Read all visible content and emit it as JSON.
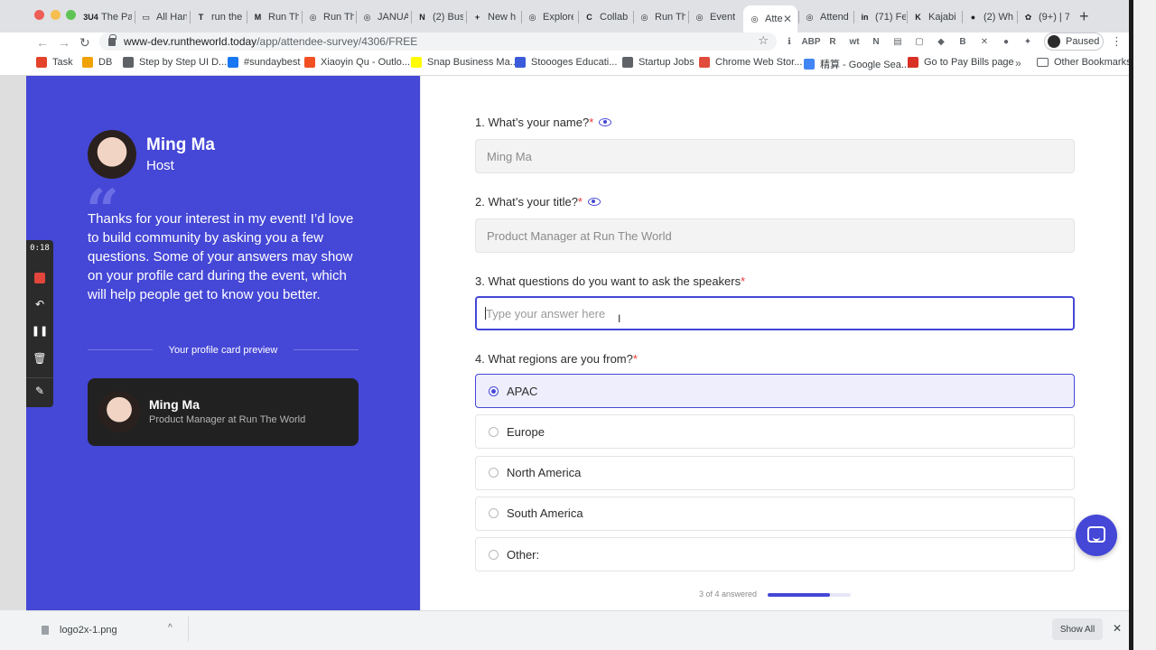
{
  "browser": {
    "tabs": [
      {
        "favicon": "3U4",
        "label": "The Pa",
        "active": false
      },
      {
        "favicon": "▭",
        "label": "All Han",
        "active": false
      },
      {
        "favicon": "T",
        "label": "run the",
        "active": false
      },
      {
        "favicon": "M",
        "label": "Run Th",
        "active": false
      },
      {
        "favicon": "◎",
        "label": "Run Th",
        "active": false
      },
      {
        "favicon": "◎",
        "label": "JANUA",
        "active": false
      },
      {
        "favicon": "N",
        "label": "(2) Bus",
        "active": false
      },
      {
        "favicon": "+",
        "label": "New h",
        "active": false
      },
      {
        "favicon": "◎",
        "label": "Explore",
        "active": false
      },
      {
        "favicon": "C",
        "label": "Collab",
        "active": false
      },
      {
        "favicon": "◎",
        "label": "Run Th",
        "active": false
      },
      {
        "favicon": "◎",
        "label": "Event",
        "active": false
      },
      {
        "favicon": "◎",
        "label": "Atte",
        "active": true
      },
      {
        "favicon": "◎",
        "label": "Attend",
        "active": false
      },
      {
        "favicon": "in",
        "label": "(71) Fe",
        "active": false
      },
      {
        "favicon": "K",
        "label": "Kajabi",
        "active": false
      },
      {
        "favicon": "●",
        "label": "(2) Wh",
        "active": false
      },
      {
        "favicon": "✿",
        "label": "(9+) | 7",
        "active": false
      }
    ],
    "url_host": "www-dev.runtheworld.today",
    "url_path": "/app/attendee-survey/4306/FREE",
    "extensions": [
      "ℹ",
      "ABP",
      "R",
      "wt",
      "N",
      "▤",
      "▢",
      "◆",
      "B",
      "✕",
      "●",
      "✦"
    ],
    "profile_label": "Paused",
    "bookmarks": [
      {
        "icon": "gitlab-icon",
        "color": "#e2432a",
        "label": "Task"
      },
      {
        "icon": "db-icon",
        "color": "#f0a202",
        "label": "DB"
      },
      {
        "icon": "step-icon",
        "color": "#5f6368",
        "label": "Step by Step UI D..."
      },
      {
        "icon": "facebook-icon",
        "color": "#1877f2",
        "label": "#sundaybest"
      },
      {
        "icon": "microsoft-icon",
        "color": "#f25022",
        "label": "Xiaoyin Qu - Outlo..."
      },
      {
        "icon": "snapchat-icon",
        "color": "#fffc00",
        "label": "Snap Business Ma..."
      },
      {
        "icon": "c-icon",
        "color": "#3b5bdb",
        "label": "Stoooges Educati..."
      },
      {
        "icon": "startup-icon",
        "color": "#5f6368",
        "label": "Startup Jobs"
      },
      {
        "icon": "chrome-store-icon",
        "color": "#e04b3c",
        "label": "Chrome Web Stor..."
      },
      {
        "icon": "google-icon",
        "color": "#4285f4",
        "label": "精算 - Google Sea..."
      },
      {
        "icon": "bill-icon",
        "color": "#d93025",
        "label": "Go to Pay Bills page"
      }
    ],
    "bookmarks_more": "»",
    "other_bookmarks": "Other Bookmarks"
  },
  "host": {
    "name": "Ming Ma",
    "role": "Host",
    "intro": "Thanks for your interest in my event! I’d love to build community by asking you a few questions. Some of your answers may show on your profile card during the event, which will help people get to know you better.",
    "preview_label": "Your profile card preview",
    "card_name": "Ming Ma",
    "card_title": "Product Manager at Run The World"
  },
  "recorder": {
    "time": "0:18"
  },
  "survey": {
    "questions": [
      {
        "label": "1. What’s your name?",
        "required": "*",
        "value": "Ming Ma"
      },
      {
        "label": "2. What’s your title?",
        "required": "*",
        "value": "Product Manager at Run The World"
      },
      {
        "label": "3. What questions do you want to ask the speakers",
        "required": "*",
        "placeholder": "Type your answer here"
      },
      {
        "label": "4. What regions are you from?",
        "required": "*"
      }
    ],
    "regions": [
      "APAC",
      "Europe",
      "North America",
      "South America",
      "Other:"
    ],
    "selected_region": "APAC",
    "progress_text": "3 of 4 answered",
    "progress_fraction": 0.75
  },
  "downloads": {
    "filename": "logo2x-1.png",
    "show_all": "Show All"
  },
  "colors": {
    "accent": "#4547d6",
    "required": "#e53935",
    "card_bg": "#212121"
  }
}
